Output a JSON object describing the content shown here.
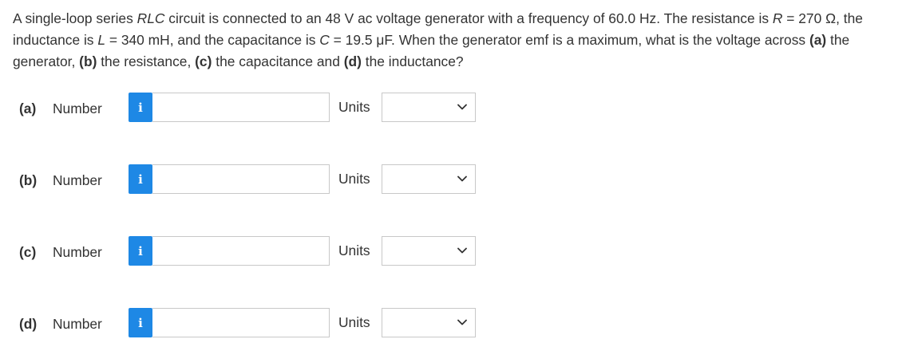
{
  "question": {
    "part1": "A single-loop series ",
    "rlc": "RLC",
    "part2": " circuit is connected to an 48 V ac voltage generator with a frequency of 60.0 Hz. The resistance is ",
    "r_var": "R",
    "part3": " = 270 Ω, the inductance is ",
    "l_var": "L",
    "part4": " = 340 mH, and the capacitance is ",
    "c_var": "C",
    "part5": " = 19.5 μF. When the generator emf is a maximum, what is the voltage across ",
    "a": "(a)",
    "part6": " the generator, ",
    "b": "(b)",
    "part7": " the resistance, ",
    "c": "(c)",
    "part8": " the capacitance and ",
    "d": "(d)",
    "part9": " the inductance?"
  },
  "answers": [
    {
      "label": "(a)",
      "number_label": "Number",
      "info_icon": "i",
      "value": "",
      "units_label": "Units",
      "units_value": ""
    },
    {
      "label": "(b)",
      "number_label": "Number",
      "info_icon": "i",
      "value": "",
      "units_label": "Units",
      "units_value": ""
    },
    {
      "label": "(c)",
      "number_label": "Number",
      "info_icon": "i",
      "value": "",
      "units_label": "Units",
      "units_value": ""
    },
    {
      "label": "(d)",
      "number_label": "Number",
      "info_icon": "i",
      "value": "",
      "units_label": "Units",
      "units_value": ""
    }
  ],
  "colors": {
    "info_button": "#1e88e5",
    "text": "#333333",
    "border": "#c8c8c8"
  },
  "icons": {
    "info": "info-icon",
    "dropdown": "chevron-down-icon"
  }
}
